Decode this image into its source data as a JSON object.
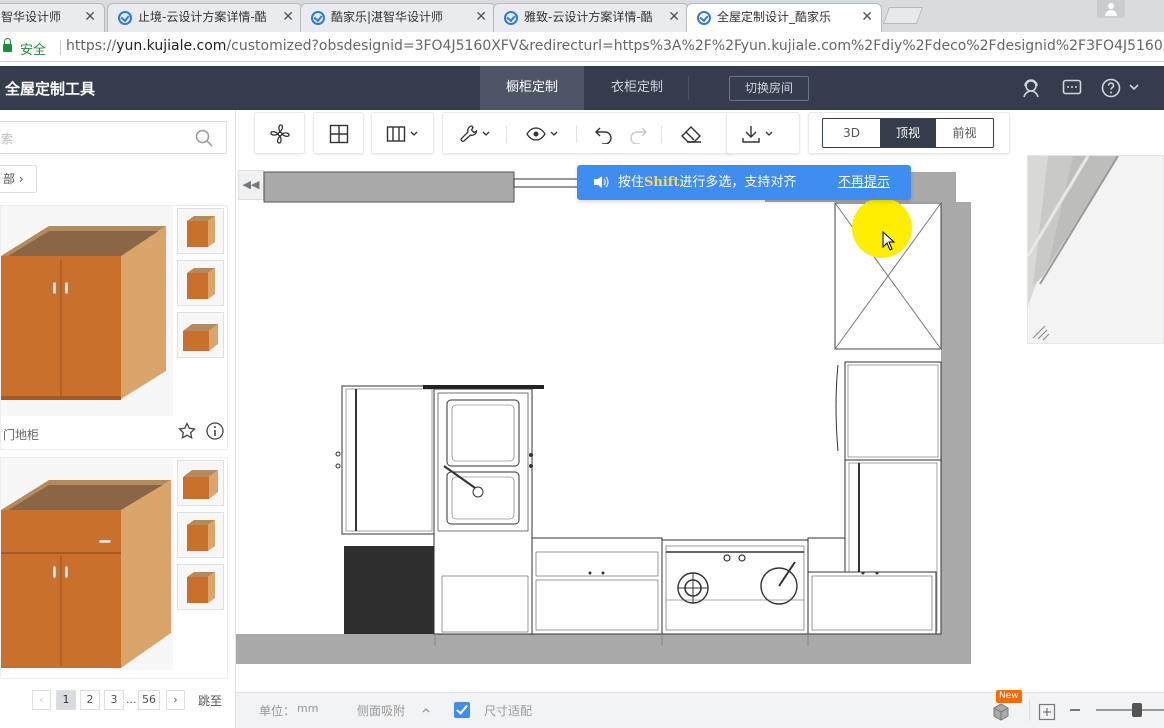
{
  "browser": {
    "tabs": [
      {
        "title": "智华设计师"
      },
      {
        "title": "止境-云设计方案详情-酷"
      },
      {
        "title": "酷家乐|湛智华设计师"
      },
      {
        "title": "雅致-云设计方案详情-酷"
      },
      {
        "title": "全屋定制设计_酷家乐"
      }
    ],
    "secure_label": "安全",
    "url_scheme": "https://",
    "url_host": "yun.kujiale.com",
    "url_rest": "/customized?obsdesignid=3FO4J5160XFV&redirecturl=https%3A%2F%2Fyun.kujiale.com%2Fdiy%2Fdeco%2Fdesignid%2F3FO4J5160XFV%3F"
  },
  "app": {
    "title": "全屋定制工具",
    "tabs": [
      {
        "label": "橱柜定制"
      },
      {
        "label": "衣柜定制"
      }
    ],
    "switch_room": "切换房间"
  },
  "left": {
    "search_placeholder": "索",
    "category": "部",
    "products": [
      {
        "name": "门地柜"
      },
      {
        "name": ""
      }
    ],
    "pagination": {
      "pages": [
        "1",
        "2",
        "3",
        "...",
        "56"
      ],
      "goto": "跳至"
    }
  },
  "toolbar": {
    "views": [
      "3D",
      "顶视",
      "前视"
    ]
  },
  "notice": {
    "prefix": "按住",
    "key": "Shift",
    "suffix": "进行多选，支持对齐",
    "dismiss": "不再提示"
  },
  "bottom": {
    "unit_label": "单位：",
    "unit_value": "mm",
    "side_snap": "侧面吸附",
    "fit_size": "尺寸适配",
    "badge": "New"
  },
  "colors": {
    "header_bg": "#353c4c",
    "active_tab": "#4d5566",
    "accent": "#3f8df0",
    "cursor_highlight": "#ffee00"
  }
}
